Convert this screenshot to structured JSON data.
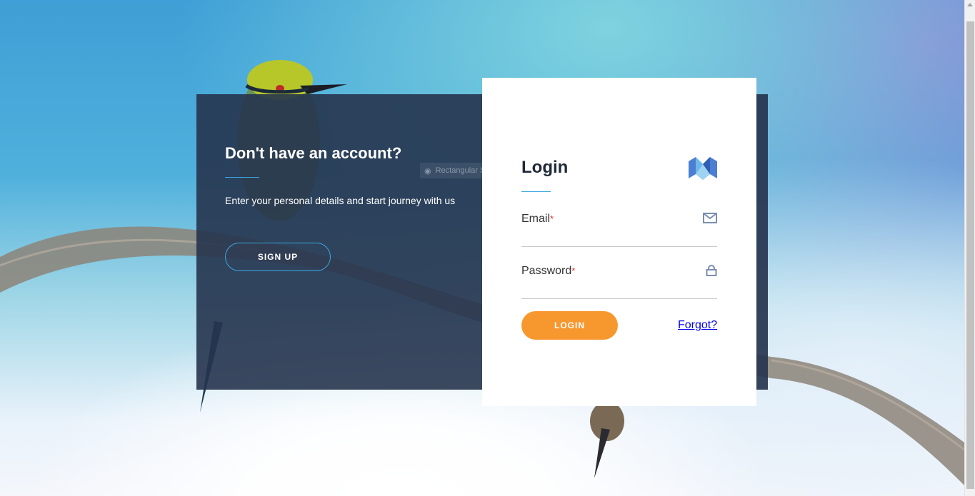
{
  "signup_panel": {
    "title": "Don't have an account?",
    "description": "Enter your personal details and start journey with us",
    "signup_label": "SIGN UP"
  },
  "login_panel": {
    "title": "Login",
    "email_label": "Email",
    "password_label": "Password",
    "required_mark": "*",
    "login_label": "LOGIN",
    "forgot_label": "Forgot?"
  },
  "overlay": {
    "snip_label": "Rectangular Snip"
  },
  "icons": {
    "email": "mail-icon",
    "password": "lock-icon",
    "logo": "m-logo-icon"
  },
  "colors": {
    "panel_dark": "#26344e",
    "accent_blue": "#3aa7e0",
    "login_orange": "#f7982f",
    "required_red": "#e03131",
    "link_blue": "#0000ee"
  }
}
